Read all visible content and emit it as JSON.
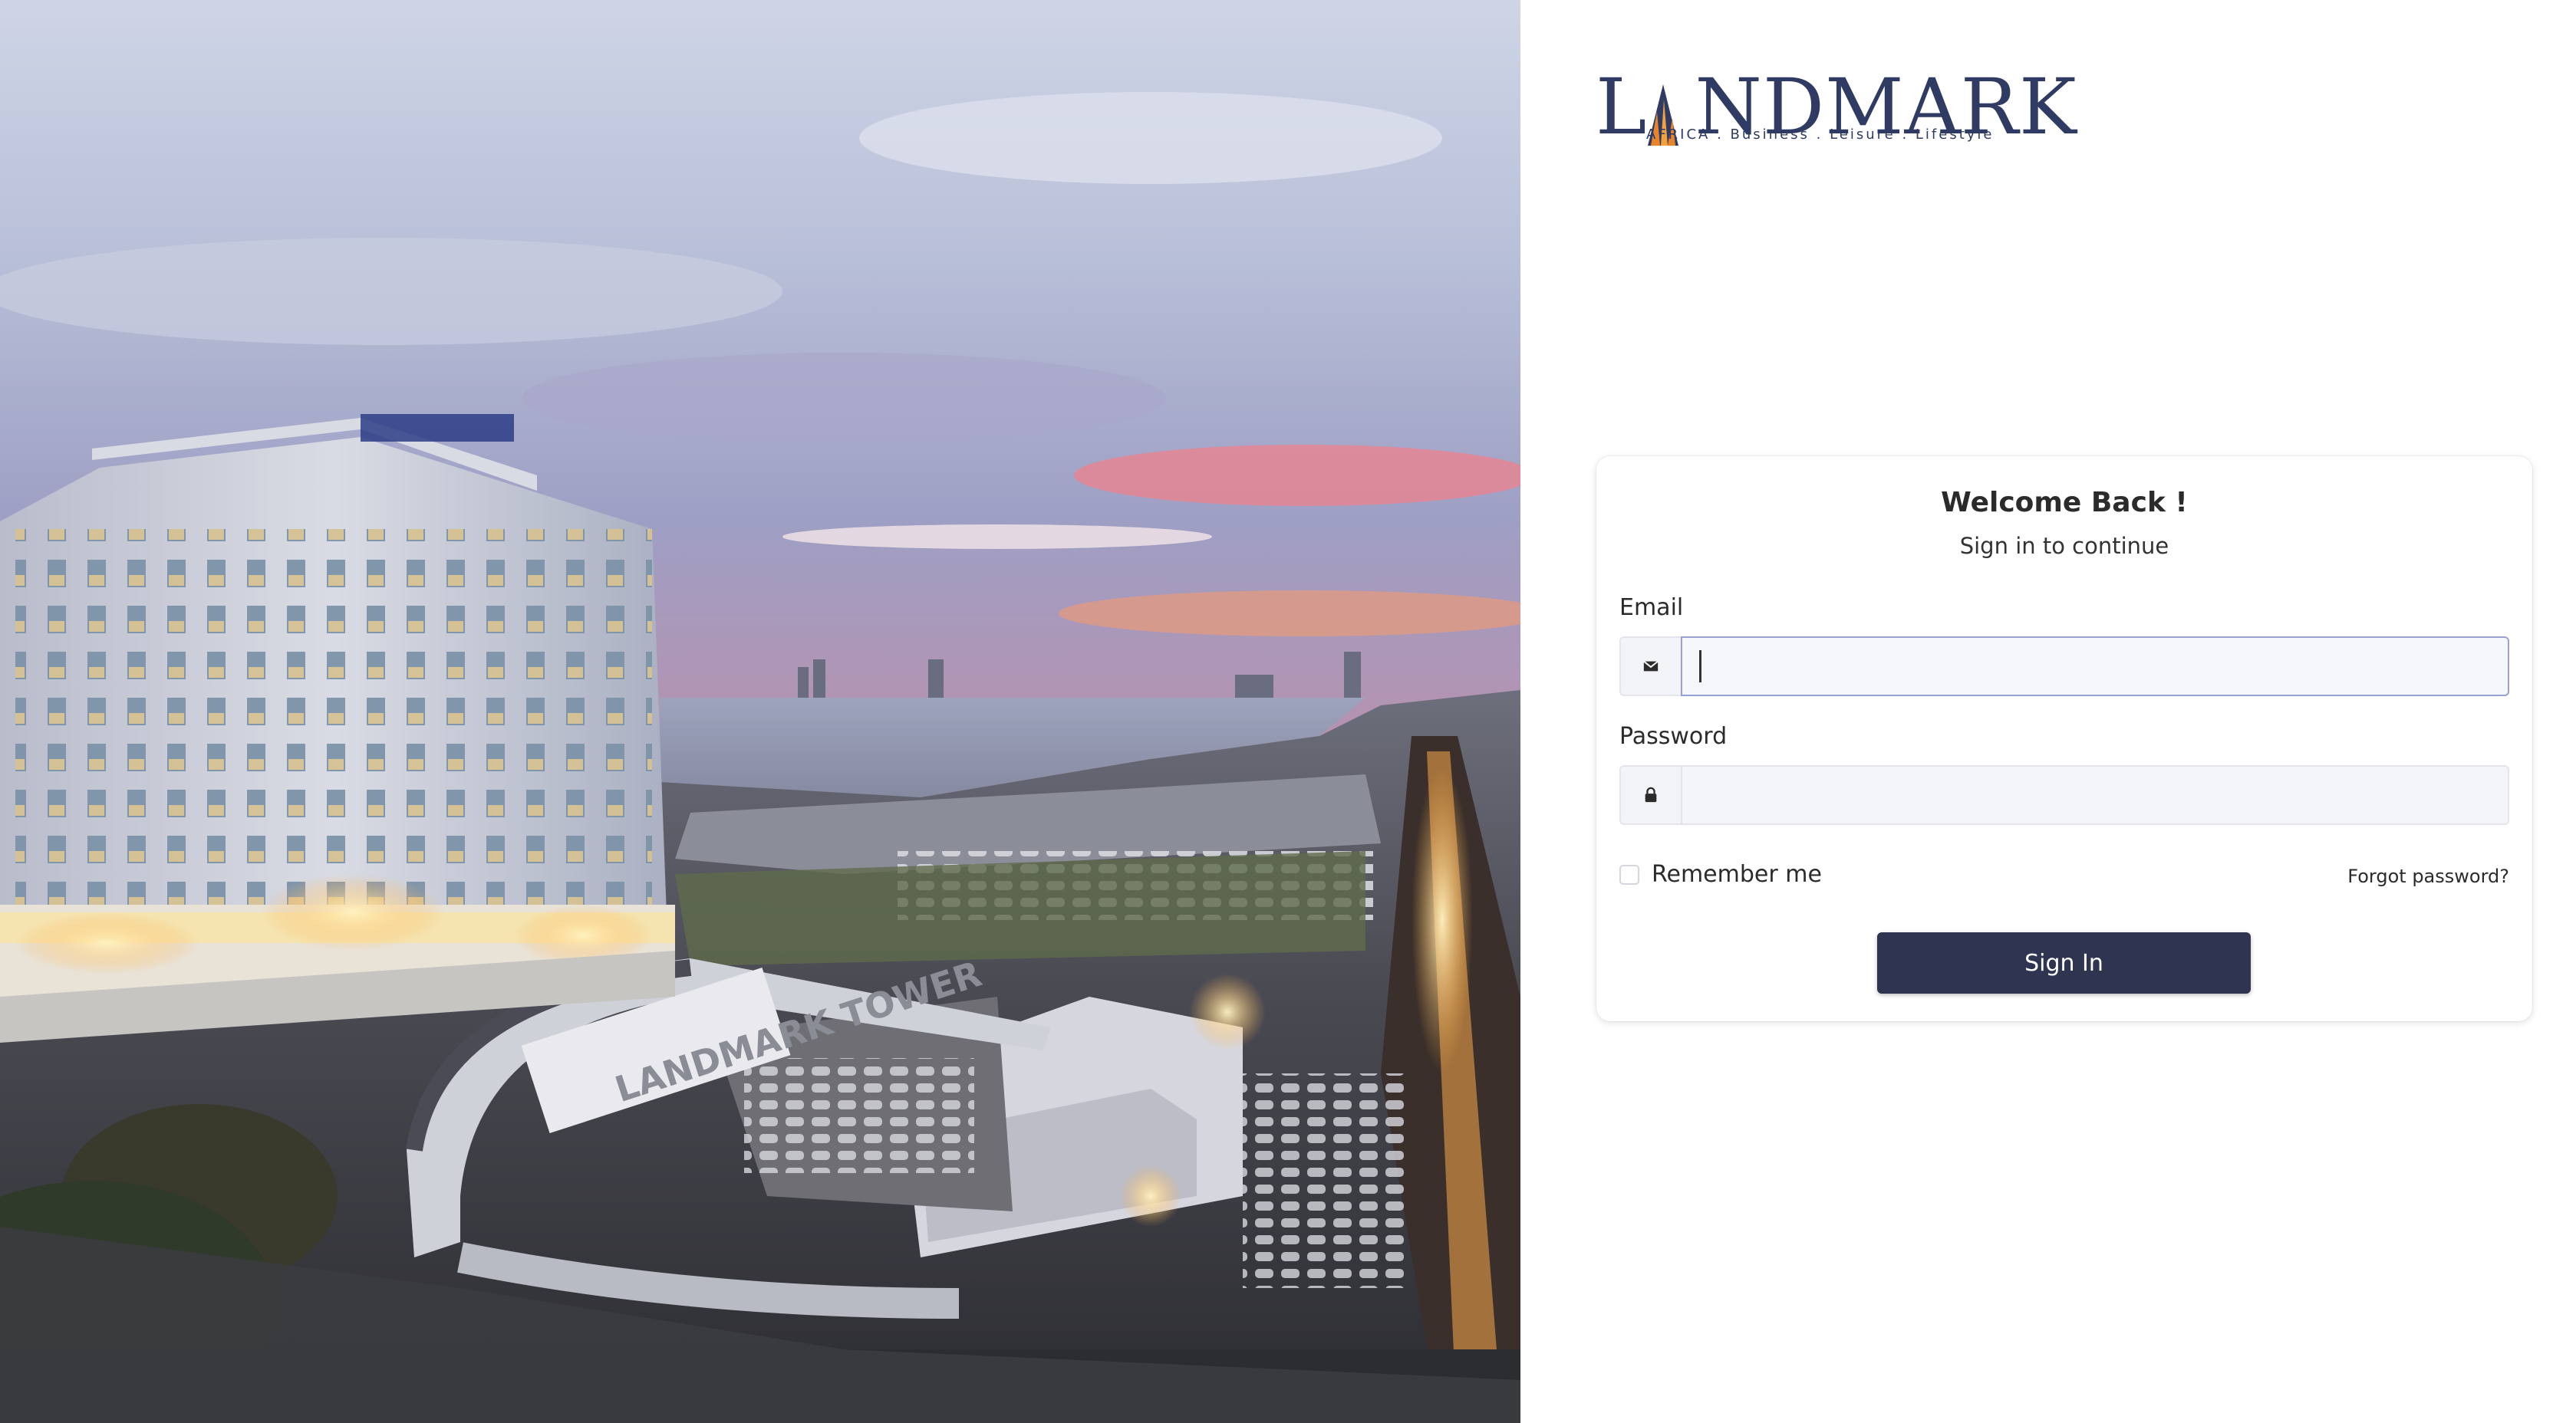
{
  "photo": {
    "sign_text": "LANDMARK TOWER"
  },
  "brand": {
    "logo_text": "LANDMARK",
    "logo_first": "L",
    "logo_rest": "NDMARK",
    "tagline": "AFRICA . Business . Leisure . Lifestyle",
    "color": "#2f3b63",
    "accent": "#e8842b"
  },
  "card": {
    "title": "Welcome Back !",
    "subtitle": "Sign in to continue"
  },
  "form": {
    "email_label": "Email",
    "email_value": "",
    "email_placeholder": "",
    "email_icon": "envelope-icon",
    "password_label": "Password",
    "password_value": "",
    "password_placeholder": "",
    "password_icon": "lock-icon",
    "remember_label": "Remember me",
    "remember_checked": false,
    "forgot_label": "Forgot password?",
    "submit_label": "Sign In",
    "submit_color": "#2f3450"
  }
}
